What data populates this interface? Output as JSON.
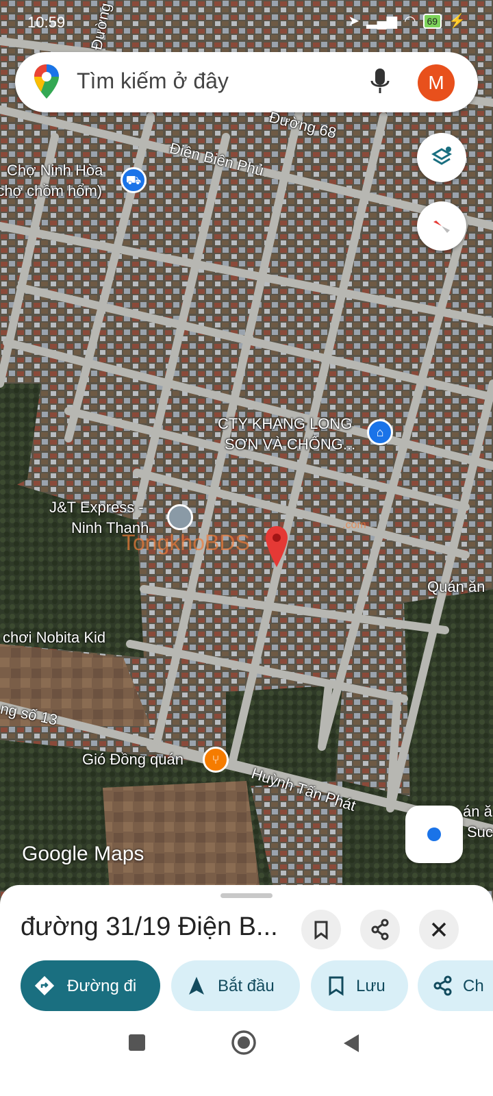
{
  "status_bar": {
    "time": "10:59",
    "battery": "69"
  },
  "search": {
    "placeholder": "Tìm kiếm ở đây",
    "avatar_letter": "M"
  },
  "map_labels": {
    "road_68": "Đường 68",
    "road_top": "Đường",
    "road_dien_bien_phu": "Điện Biên Phủ",
    "market_name": "Chợ Ninh Hòa",
    "market_sub": "(chợ chồm hổm)",
    "company_line1": "CTY KHANG LONG",
    "company_line2": "SƠN VÀ CHỐNG...",
    "express_line1": "J&T Express -",
    "express_line2": "Ninh Thanh",
    "quan_an": "Quán ăn",
    "nobita": "chơi Nobita Kid",
    "road_13": "ng số 13",
    "gio_dong": "Gió Đồng quán",
    "road_huynh": "Huỳnh Tấn Phát",
    "right_partial_1": "án ă",
    "right_partial_2": "Suc",
    "watermark": "TongkhoBDS",
    "watermark_sub": ".com",
    "google_maps": "Google Maps"
  },
  "place": {
    "title": "đường 31/19 Điện B..."
  },
  "actions": {
    "directions": "Đường đi",
    "start": "Bắt đầu",
    "save": "Lưu",
    "share": "Ch"
  },
  "colors": {
    "primary": "#1a6f80",
    "chip_bg": "#d9eff7",
    "pin_red": "#e53935",
    "avatar": "#e8501c",
    "poi_blue": "#1a73e8",
    "poi_orange": "#f57c00"
  }
}
